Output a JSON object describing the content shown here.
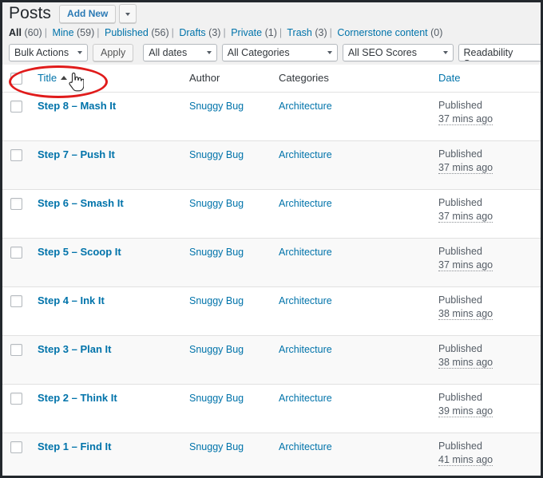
{
  "header": {
    "page_title": "Posts",
    "add_new_label": "Add New",
    "split_caret_icon": "chevron-down-icon"
  },
  "status_filters": [
    {
      "label": "All",
      "count": "(60)",
      "current": true
    },
    {
      "label": "Mine",
      "count": "(59)",
      "current": false
    },
    {
      "label": "Published",
      "count": "(56)",
      "current": false
    },
    {
      "label": "Drafts",
      "count": "(3)",
      "current": false
    },
    {
      "label": "Private",
      "count": "(1)",
      "current": false
    },
    {
      "label": "Trash",
      "count": "(3)",
      "current": false
    },
    {
      "label": "Cornerstone content",
      "count": "(0)",
      "current": false
    }
  ],
  "separator": "|",
  "tablenav": {
    "bulk_actions_value": "Bulk Actions",
    "apply_label": "Apply",
    "dates_value": "All dates",
    "categories_value": "All Categories",
    "seo_scores_value": "All SEO Scores",
    "readability_value": "All Readability Scores",
    "caret_icon": "chevron-down-icon"
  },
  "table": {
    "columns": {
      "checkbox": "select-all-checkbox",
      "title": "Title",
      "author": "Author",
      "categories": "Categories",
      "date": "Date"
    },
    "sort": {
      "column": "Title",
      "direction": "asc",
      "icon": "sort-ascending-icon"
    },
    "rows": [
      {
        "title": "Step 8 – Mash It",
        "author": "Snuggy Bug",
        "categories": "Architecture",
        "status": "Published",
        "ago": "37 mins ago"
      },
      {
        "title": "Step 7 – Push It",
        "author": "Snuggy Bug",
        "categories": "Architecture",
        "status": "Published",
        "ago": "37 mins ago"
      },
      {
        "title": "Step 6 – Smash It",
        "author": "Snuggy Bug",
        "categories": "Architecture",
        "status": "Published",
        "ago": "37 mins ago"
      },
      {
        "title": "Step 5 – Scoop It",
        "author": "Snuggy Bug",
        "categories": "Architecture",
        "status": "Published",
        "ago": "37 mins ago"
      },
      {
        "title": "Step 4 – Ink It",
        "author": "Snuggy Bug",
        "categories": "Architecture",
        "status": "Published",
        "ago": "38 mins ago"
      },
      {
        "title": "Step 3 – Plan It",
        "author": "Snuggy Bug",
        "categories": "Architecture",
        "status": "Published",
        "ago": "38 mins ago"
      },
      {
        "title": "Step 2 – Think It",
        "author": "Snuggy Bug",
        "categories": "Architecture",
        "status": "Published",
        "ago": "39 mins ago"
      },
      {
        "title": "Step 1 – Find It",
        "author": "Snuggy Bug",
        "categories": "Architecture",
        "status": "Published",
        "ago": "41 mins ago"
      }
    ]
  },
  "annotations": {
    "highlight_ellipse_color": "#e01b1b",
    "cursor_icon": "pointing-hand-cursor-icon"
  },
  "colors": {
    "link": "#0073aa",
    "admin_bg": "#f1f1f1",
    "border_dark": "#23282d",
    "row_alt": "#f9f9f9"
  }
}
